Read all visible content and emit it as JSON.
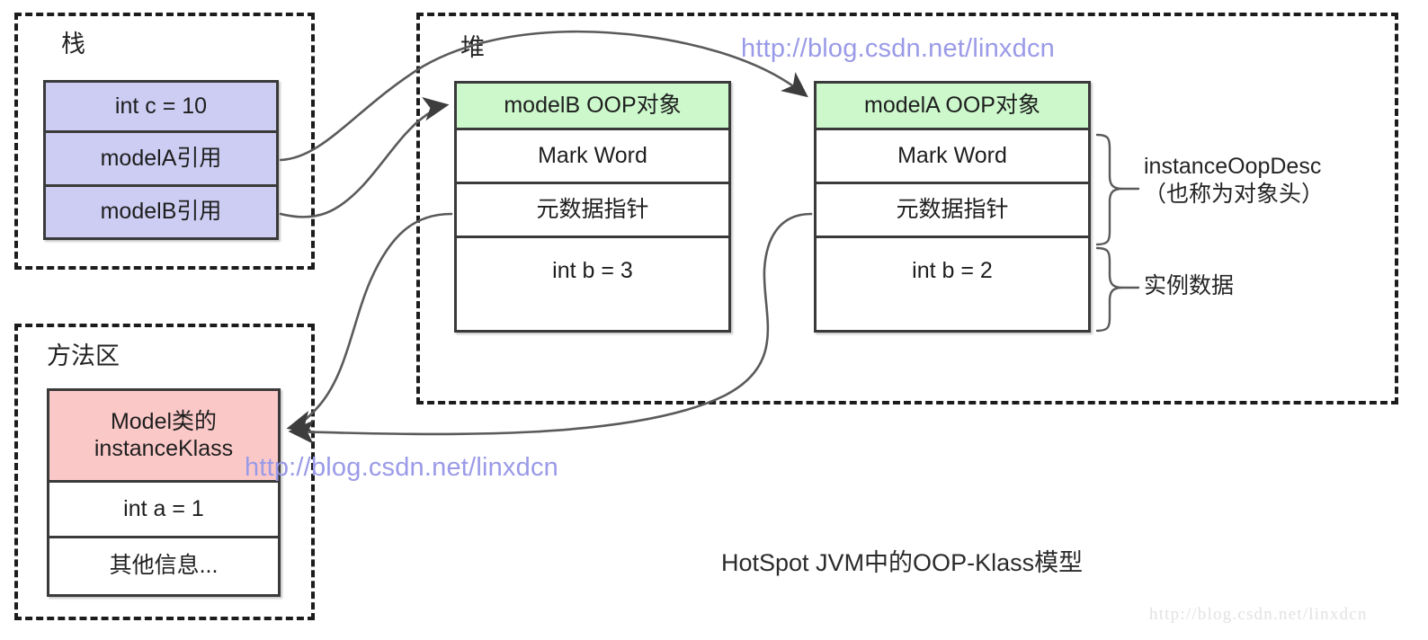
{
  "diagram": {
    "caption": "HotSpot JVM中的OOP-Klass模型",
    "watermark_primary": "http://blog.csdn.net/linxdcn",
    "watermark_secondary": "http://blog.csdn.net/linxdcn",
    "watermark_corner": "http://blog.csdn.net/linxdcn",
    "colors": {
      "stack_fill": "#cdcdf4",
      "oop_header_fill": "#ccf8cc",
      "klass_header_fill": "#fbc8c8",
      "border": "#3a3a3a",
      "region_border": "#1c1c1c",
      "watermark": "#9a9ae8"
    }
  },
  "regions": {
    "stack": {
      "label": "栈"
    },
    "heap": {
      "label": "堆"
    },
    "method_area": {
      "label": "方法区"
    }
  },
  "stack_frame": {
    "rows": [
      {
        "text": "int c = 10"
      },
      {
        "text": "modelA引用"
      },
      {
        "text": "modelB引用"
      }
    ]
  },
  "model_b_oop": {
    "rows": [
      {
        "text": "modelB OOP对象"
      },
      {
        "text": "Mark Word"
      },
      {
        "text": "元数据指针"
      },
      {
        "text": "int b = 3"
      }
    ]
  },
  "model_a_oop": {
    "rows": [
      {
        "text": "modelA OOP对象"
      },
      {
        "text": "Mark Word"
      },
      {
        "text": "元数据指针"
      },
      {
        "text": "int b = 2"
      }
    ]
  },
  "instance_klass": {
    "rows": [
      {
        "text": "Model类的\ninstanceKlass"
      },
      {
        "text": "int a = 1"
      },
      {
        "text": "其他信息..."
      }
    ]
  },
  "annotations": [
    {
      "text": "instanceOopDesc\n（也称为对象头）"
    },
    {
      "text": "实例数据"
    }
  ]
}
